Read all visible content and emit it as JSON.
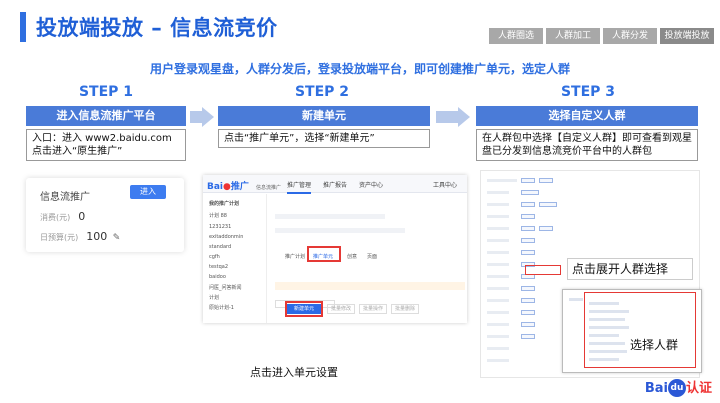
{
  "header": {
    "title": "投放端投放 – 信息流竞价",
    "tabs": [
      "人群圈选",
      "人群加工",
      "人群分发",
      "投放端投放"
    ]
  },
  "subtitle": "用户登录观星盘，人群分发后，登录投放端平台，即可创建推广单元，选定人群",
  "steps": [
    {
      "label": "STEP 1",
      "title": "进入信息流推广平台",
      "desc": [
        "入口：进入 www2.baidu.com",
        "点击进入“原生推广”"
      ]
    },
    {
      "label": "STEP 2",
      "title": "新建单元",
      "desc": [
        "点击“推广单元”，选择“新建单元”"
      ]
    },
    {
      "label": "STEP 3",
      "title": "选择自定义人群",
      "desc": [
        "在人群包中选择【自定义人群】即可查看到观星",
        "盘已分发到信息流竞价平台中的人群包"
      ]
    }
  ],
  "panel1": {
    "name": "信息流推广",
    "button": "进入",
    "rows": [
      {
        "label": "消费(元)",
        "value": "0"
      },
      {
        "label": "日预算(元)",
        "value": "100"
      }
    ]
  },
  "panel2": {
    "logo_a": "Bai",
    "logo_b": "推广",
    "logo_c": "信息流推广",
    "nav": [
      "推广管理",
      "推广报告",
      "资产中心",
      "工具中心"
    ],
    "sidebar": [
      "我的推广计划",
      "计划 88",
      "1231231",
      "exitaddonmin",
      "standard",
      "cgfh",
      "testqa2",
      "baidoo",
      "问医_问答新闻",
      "计划",
      "原始计划-1"
    ],
    "tabs": [
      "推广计划",
      "推广单元",
      "创意",
      "页面"
    ],
    "new_unit_button": "新建单元",
    "gray_buttons": [
      "批量修改",
      "批量操作",
      "批量删除"
    ],
    "caption": "点击进入单元设置"
  },
  "panel3": {
    "callout_expand": "点击展开人群选择",
    "callout_select": "选择人群"
  },
  "brand": {
    "a": "Bai",
    "du": "du",
    "b": "认证"
  }
}
